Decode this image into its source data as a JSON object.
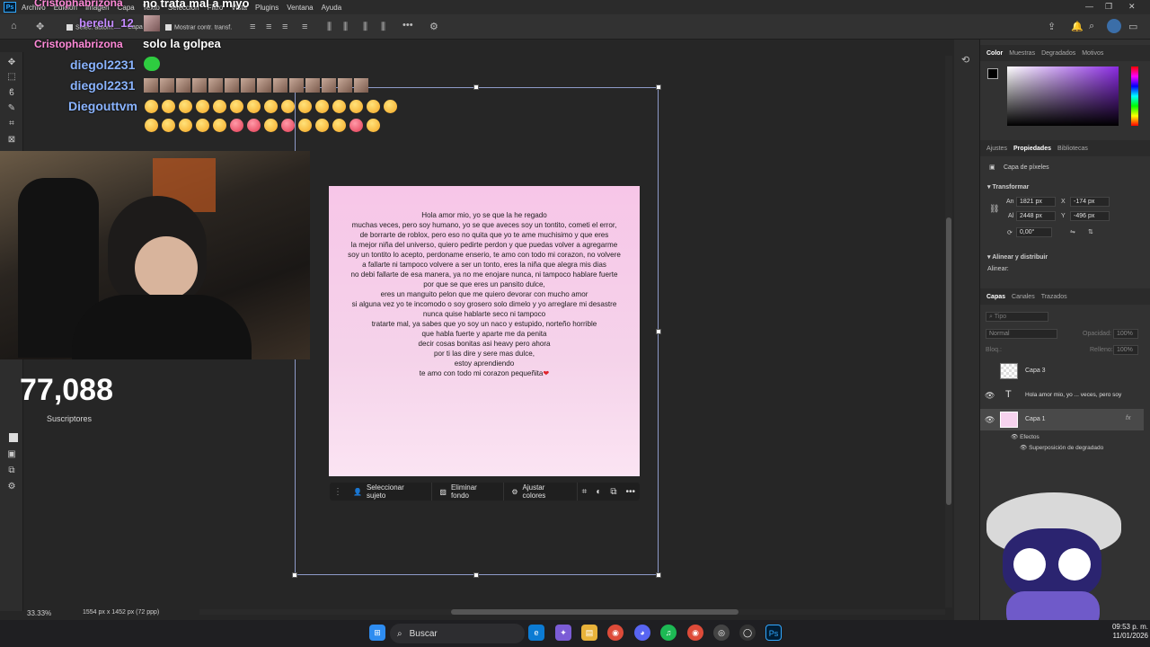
{
  "menubar": {
    "logo": "Ps",
    "items": [
      "Archivo",
      "Edición",
      "Imagen",
      "Capa",
      "Texto",
      "Selección",
      "Filtro",
      "Vista",
      "Plugins",
      "Ventana",
      "Ayuda"
    ]
  },
  "optionsbar": {
    "auto_select_label": "Selec. autom.",
    "layer_dropdown": "Capa",
    "show_transform_label": "Mostrar contr. transf."
  },
  "chat": {
    "overlay_name_1": "Cristophabrizona",
    "overlay_msg_1": "no trata mal a miyo",
    "overlay_name_2": "berelu_12",
    "overlay_name_3": "Cristophabrizona",
    "overlay_msg_3": "solo la golpea",
    "name_diego1": "diegol2231",
    "name_diego2": "diegol2231",
    "name_diegouttvm": "Diegouttvm"
  },
  "document": {
    "lines": [
      "Hola amor mio, yo se que la he regado",
      "muchas veces, pero  soy humano, yo se que aveces soy un tontito, cometi el error,",
      "de borrarte de roblox, pero eso no  quita que yo te ame muchisimo y que eres",
      "la mejor niña del universo, quiero pedirte perdon y que puedas volver a agregarme",
      "soy un tontito lo acepto, perdoname enserio, te amo con todo mi corazon, no volvere",
      "a fallarte ni tampoco volvere a ser un tonto, eres la niña que alegra mis dias",
      "no debi fallarte de esa manera, ya no me enojare nunca, ni tampoco hablare fuerte",
      "por que se que eres un pansito dulce,",
      "eres un manguito pelon que me quiero devorar con mucho amor",
      "si alguna vez yo te incomodo o soy grosero solo dimelo y yo arreglare mi desastre",
      "nunca quise hablarte seco ni tampoco",
      "tratarte mal, ya sabes que yo soy un naco y estupido, norteño horrible",
      "que habla fuerte y aparte me da penita",
      "decir cosas bonitas asi heavy pero ahora",
      "por ti las dire y sere mas dulce,",
      "estoy aprendiendo"
    ],
    "last_line": "te amo con todo mi corazon pequeñita",
    "heart": "❤"
  },
  "contextbar": {
    "select_subject": "Seleccionar sujeto",
    "remove_bg": "Eliminar fondo",
    "adjust_colors": "Ajustar colores"
  },
  "stream": {
    "sub_count": "77,088",
    "sub_label": "Suscriptores"
  },
  "status": {
    "zoom": "33.33%",
    "doc_info": "1554 px x 1452 px (72 ppp)"
  },
  "color_panel": {
    "tabs": [
      "Color",
      "Muestras",
      "Degradados",
      "Motivos"
    ],
    "colors": {
      "gradient_hue": "#8a2be2",
      "fg": "#000000",
      "bg": "#ffffff"
    }
  },
  "properties_panel": {
    "tabs": [
      "Ajustes",
      "Propiedades",
      "Bibliotecas"
    ],
    "kind": "Capa de píxeles",
    "section_transform": "Transformar",
    "an_label": "An",
    "an_value": "1821 px",
    "x_label": "X",
    "x_value": "-174 px",
    "al_label": "Al",
    "al_value": "2448 px",
    "y_label": "Y",
    "y_value": "-496 px",
    "angle": "0,00°",
    "section_align": "Alinear y distribuir",
    "align_label": "Alinear:"
  },
  "layers_panel": {
    "tabs": [
      "Capas",
      "Canales",
      "Trazados"
    ],
    "search_placeholder": "Tipo",
    "blend_mode": "Normal",
    "opacity_label": "Opacidad:",
    "opacity_value": "100%",
    "lock_label": "Bloq.:",
    "fill_label": "Relleno:",
    "fill_value": "100%",
    "layers": [
      {
        "name": "Capa 3"
      },
      {
        "name": "Hola amor mio, yo ... veces, pero  soy"
      },
      {
        "name": "Capa 1"
      }
    ],
    "effects_label": "Efectos",
    "effect_name": "Superposición de degradado",
    "fx": "fx"
  },
  "taskbar": {
    "search": "Buscar",
    "time": "09:53 p. m.",
    "date": "11/01/2026"
  }
}
